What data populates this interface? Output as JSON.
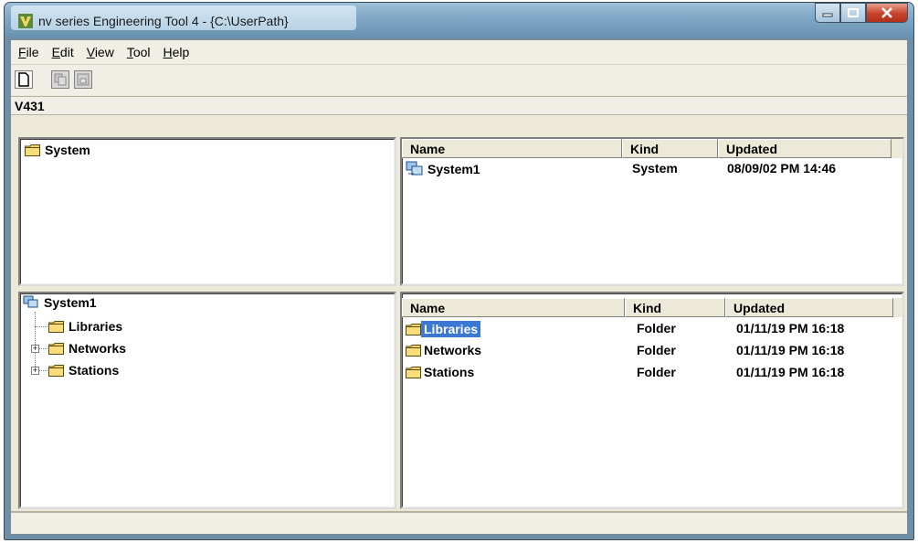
{
  "window": {
    "title": "nv series Engineering Tool 4 - {C:\\UserPath}"
  },
  "menu": [
    "File",
    "Edit",
    "View",
    "Tool",
    "Help"
  ],
  "menu_mnemonic": [
    "F",
    "E",
    "V",
    "T",
    "H"
  ],
  "address": {
    "text": "V431"
  },
  "top_left_tree": {
    "root_label": "System"
  },
  "top_right_list": {
    "columns": [
      "Name",
      "Kind",
      "Updated"
    ],
    "rows": [
      {
        "name": "System1",
        "kind": "System",
        "updated": "08/09/02 PM 14:46"
      }
    ]
  },
  "bottom_left_tree": {
    "root_label": "System1",
    "children": [
      "Libraries",
      "Networks",
      "Stations"
    ]
  },
  "bottom_right_list": {
    "columns": [
      "Name",
      "Kind",
      "Updated"
    ],
    "rows": [
      {
        "name": "Libraries",
        "kind": "Folder",
        "updated": "01/11/19 PM 16:18",
        "selected": true
      },
      {
        "name": "Networks",
        "kind": "Folder",
        "updated": "01/11/19 PM 16:18"
      },
      {
        "name": "Stations",
        "kind": "Folder",
        "updated": "01/11/19 PM 16:18"
      }
    ]
  },
  "colors": {
    "selection": "#3a78d4",
    "folder": "#f4d35e",
    "titlebar": "#7fa6c4"
  }
}
